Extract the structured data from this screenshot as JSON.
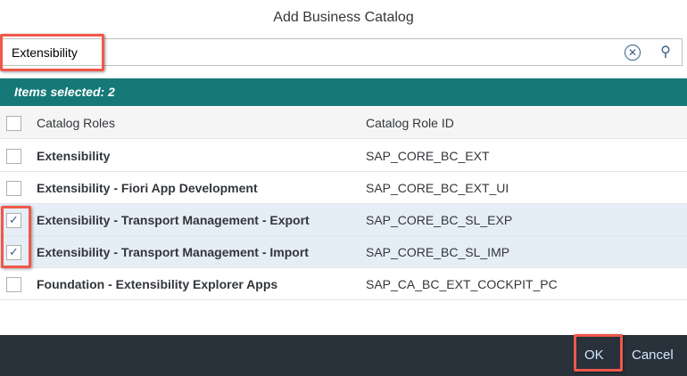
{
  "dialog": {
    "title": "Add Business Catalog"
  },
  "search": {
    "value": "Extensibility",
    "clear_icon": "clear-circle-icon",
    "search_icon": "magnifier-icon"
  },
  "info": {
    "selected_text": "Items selected: 2"
  },
  "table": {
    "headers": [
      "Catalog Roles",
      "Catalog Role ID"
    ],
    "rows": [
      {
        "role": "Extensibility",
        "id": "SAP_CORE_BC_EXT",
        "checked": false
      },
      {
        "role": "Extensibility - Fiori App Development",
        "id": "SAP_CORE_BC_EXT_UI",
        "checked": false
      },
      {
        "role": "Extensibility - Transport Management - Export",
        "id": "SAP_CORE_BC_SL_EXP",
        "checked": true
      },
      {
        "role": "Extensibility - Transport Management - Import",
        "id": "SAP_CORE_BC_SL_IMP",
        "checked": true
      },
      {
        "role": "Foundation - Extensibility Explorer Apps",
        "id": "SAP_CA_BC_EXT_COCKPIT_PC",
        "checked": false
      }
    ]
  },
  "footer": {
    "ok": "OK",
    "cancel": "Cancel"
  },
  "colors": {
    "info_bar": "#177878",
    "highlight": "#f0584a",
    "footer": "#29313a",
    "selected_row": "#e5eef6"
  }
}
